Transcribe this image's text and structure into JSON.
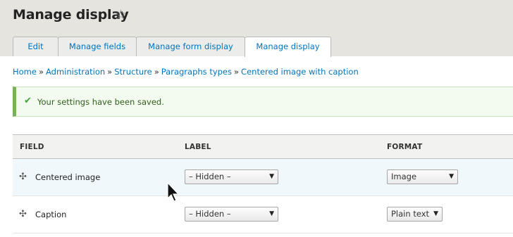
{
  "header": {
    "title": "Manage display",
    "star_icon": "☆"
  },
  "tabs": [
    {
      "label": "Edit"
    },
    {
      "label": "Manage fields"
    },
    {
      "label": "Manage form display"
    },
    {
      "label": "Manage display",
      "active": true
    }
  ],
  "breadcrumb": {
    "items": [
      "Home",
      "Administration",
      "Structure",
      "Paragraphs types",
      "Centered image with caption"
    ],
    "separator": "»"
  },
  "message": {
    "icon": "✔",
    "text": "Your settings have been saved."
  },
  "table": {
    "headers": {
      "field": "FIELD",
      "label": "LABEL",
      "format": "FORMAT"
    },
    "rows": [
      {
        "field": "Centered image",
        "label": "– Hidden –",
        "format": "Image"
      },
      {
        "field": "Caption",
        "label": "– Hidden –",
        "format": "Plain text"
      }
    ]
  },
  "colors": {
    "link": "#0074bd",
    "success_border": "#77b259",
    "header_bg": "#e6e4df"
  }
}
